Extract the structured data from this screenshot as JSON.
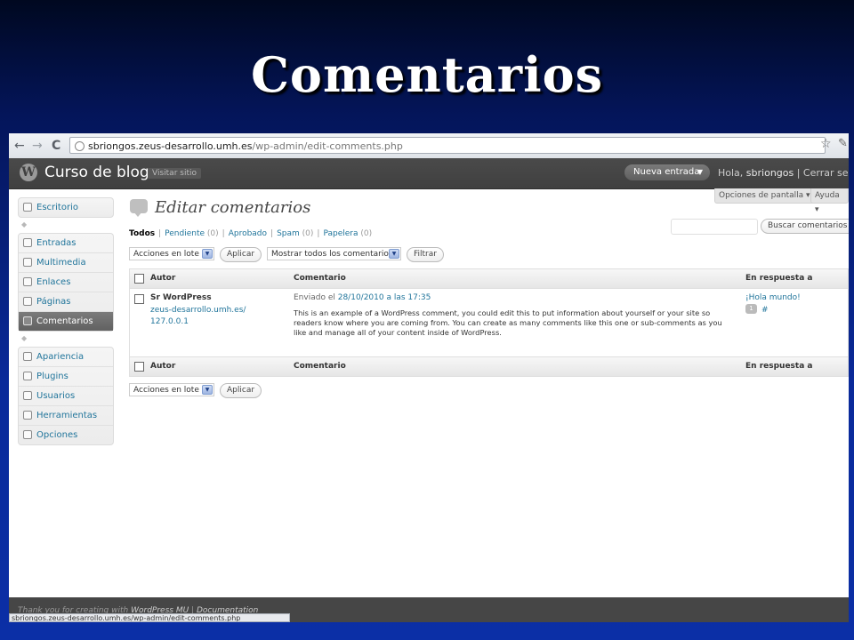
{
  "slide": {
    "title": "Comentarios"
  },
  "browser": {
    "back": "←",
    "forward": "→",
    "reload": "C",
    "url_host": "sbriongos.zeus-desarrollo.umh.es",
    "url_path": "/wp-admin/edit-comments.php",
    "status_text": "sbriongos.zeus-desarrollo.umh.es/wp-admin/edit-comments.php"
  },
  "header": {
    "logo": "W",
    "site_title": "Curso de blogs",
    "visit_site": "Visitar sitio",
    "new_entry": "Nueva entrada",
    "new_entry_arrow": "▼",
    "greeting": "Hola,",
    "username": "sbriongos",
    "logout": "| Cerrar sesión"
  },
  "screen_options": {
    "screen": "Opciones de pantalla ▾",
    "help": "Ayuda ▾"
  },
  "sidebar": {
    "group1": [
      {
        "label": "Escritorio",
        "icon": "house-icon"
      }
    ],
    "group2": [
      {
        "label": "Entradas",
        "icon": "pin-icon"
      },
      {
        "label": "Multimedia",
        "icon": "media-icon"
      },
      {
        "label": "Enlaces",
        "icon": "link-icon"
      },
      {
        "label": "Páginas",
        "icon": "pages-icon"
      },
      {
        "label": "Comentarios",
        "icon": "comment-icon",
        "active": true
      }
    ],
    "group3": [
      {
        "label": "Apariencia",
        "icon": "appearance-icon"
      },
      {
        "label": "Plugins",
        "icon": "plugin-icon"
      },
      {
        "label": "Usuarios",
        "icon": "users-icon"
      },
      {
        "label": "Herramientas",
        "icon": "tools-icon"
      },
      {
        "label": "Opciones",
        "icon": "settings-icon"
      }
    ],
    "separator": "◆"
  },
  "main": {
    "heading": "Editar comentarios",
    "filters": {
      "all": "Todos",
      "pending": "Pendiente",
      "pending_count": "(0)",
      "approved": "Aprobado",
      "spam": "Spam",
      "spam_count": "(0)",
      "trash": "Papelera",
      "trash_count": "(0)",
      "separator": "|"
    },
    "search_button": "Buscar comentarios",
    "bulk_actions": "Acciones en lote",
    "apply": "Aplicar",
    "show_all": "Mostrar todos los comentarios",
    "filter": "Filtrar",
    "table": {
      "columns": [
        "Autor",
        "Comentario",
        "En respuesta a"
      ],
      "rows": [
        {
          "author": "Sr WordPress",
          "author_url": "zeus-desarrollo.umh.es/",
          "author_ip": "127.0.0.1",
          "submitted_prefix": "Enviado el",
          "submitted_date": "28/10/2010 a las 17:35",
          "comment": "This is an example of a WordPress comment, you could edit this to put information about yourself or your site so readers know where you are coming from. You can create as many comments like this one or sub-comments as you like and manage all of your content inside of WordPress.",
          "response": "¡Hola mundo!",
          "response_count": "1",
          "response_hash": "#"
        }
      ]
    }
  },
  "footer": {
    "prefix": "Thank you for creating with",
    "link1": "WordPress MU",
    "sep": "|",
    "link2": "Documentation"
  }
}
